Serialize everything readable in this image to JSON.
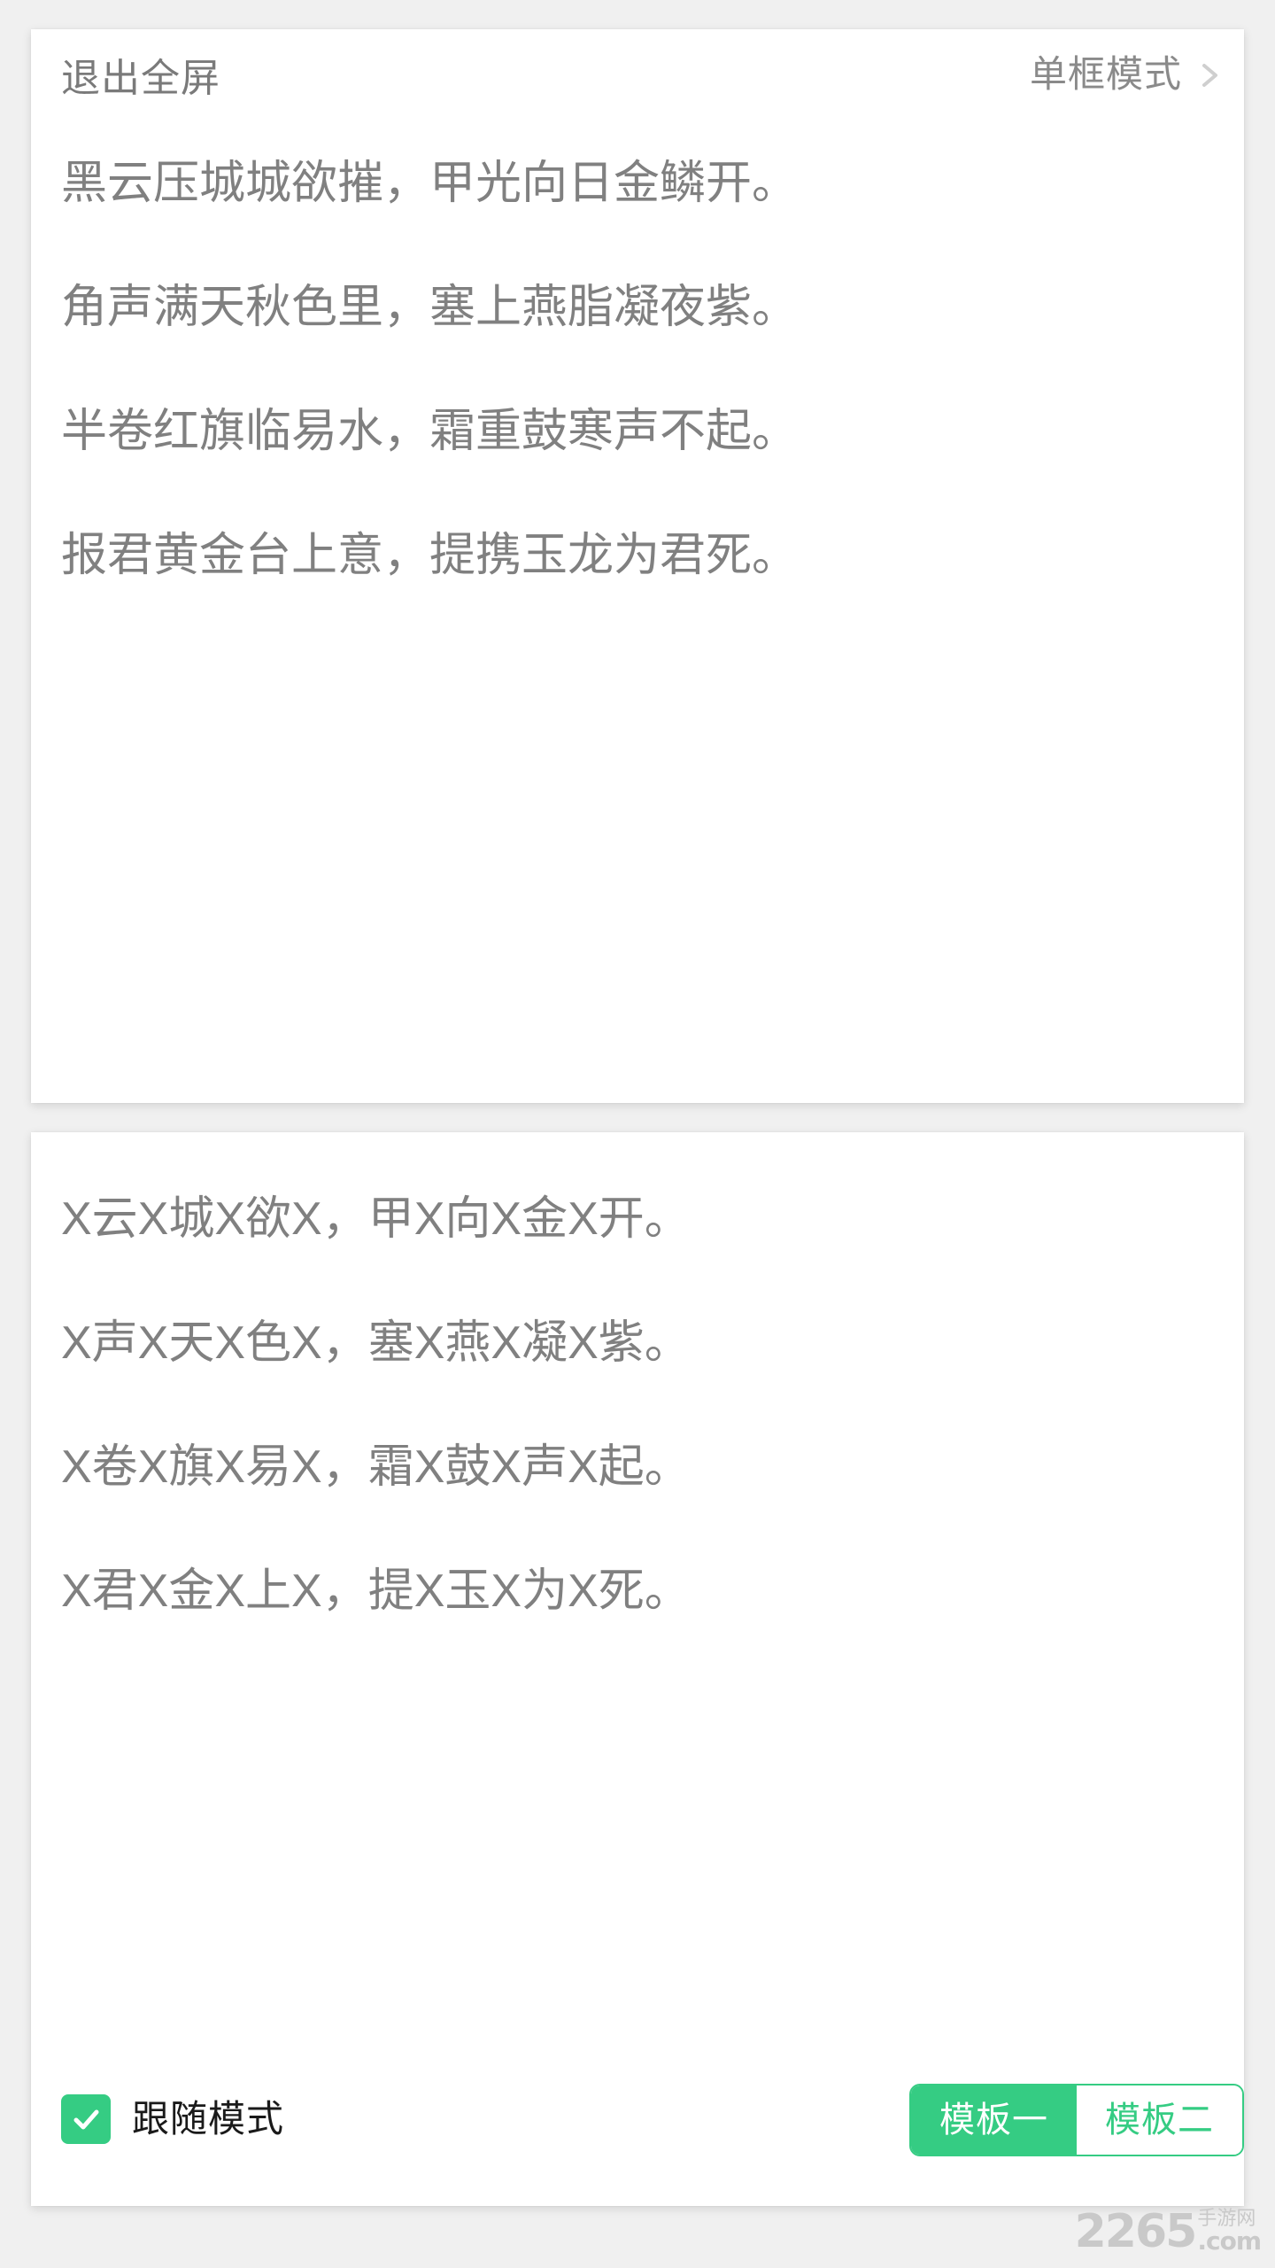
{
  "header": {
    "exit_fullscreen_label": "退出全屏",
    "mode_label": "单框模式",
    "chevron_icon": "chevron-right-icon"
  },
  "original_card": {
    "lines": [
      "黑云压城城欲摧，甲光向日金鳞开。",
      "角声满天秋色里，塞上燕脂凝夜紫。",
      "半卷红旗临易水，霜重鼓寒声不起。",
      "报君黄金台上意，提携玉龙为君死。"
    ]
  },
  "practice_card": {
    "lines": [
      "X云X城X欲X，甲X向X金X开。",
      "X声X天X色X，塞X燕X凝X紫。",
      "X卷X旗X易X，霜X鼓X声X起。",
      "X君X金X上X，提X玉X为X死。"
    ]
  },
  "footer": {
    "follow_mode_label": "跟随模式",
    "follow_mode_checked": true,
    "check_icon": "check-icon",
    "templates": [
      {
        "label": "模板一",
        "active": true
      },
      {
        "label": "模板二",
        "active": false
      }
    ]
  },
  "watermark": {
    "main": "2265",
    "cn": "手游网",
    "com": ".com"
  },
  "colors": {
    "accent_green": "#35cc83",
    "text_gray": "#808080",
    "header_gray": "#8a8a8a",
    "page_bg": "#f0f0f0",
    "card_bg": "#ffffff"
  }
}
